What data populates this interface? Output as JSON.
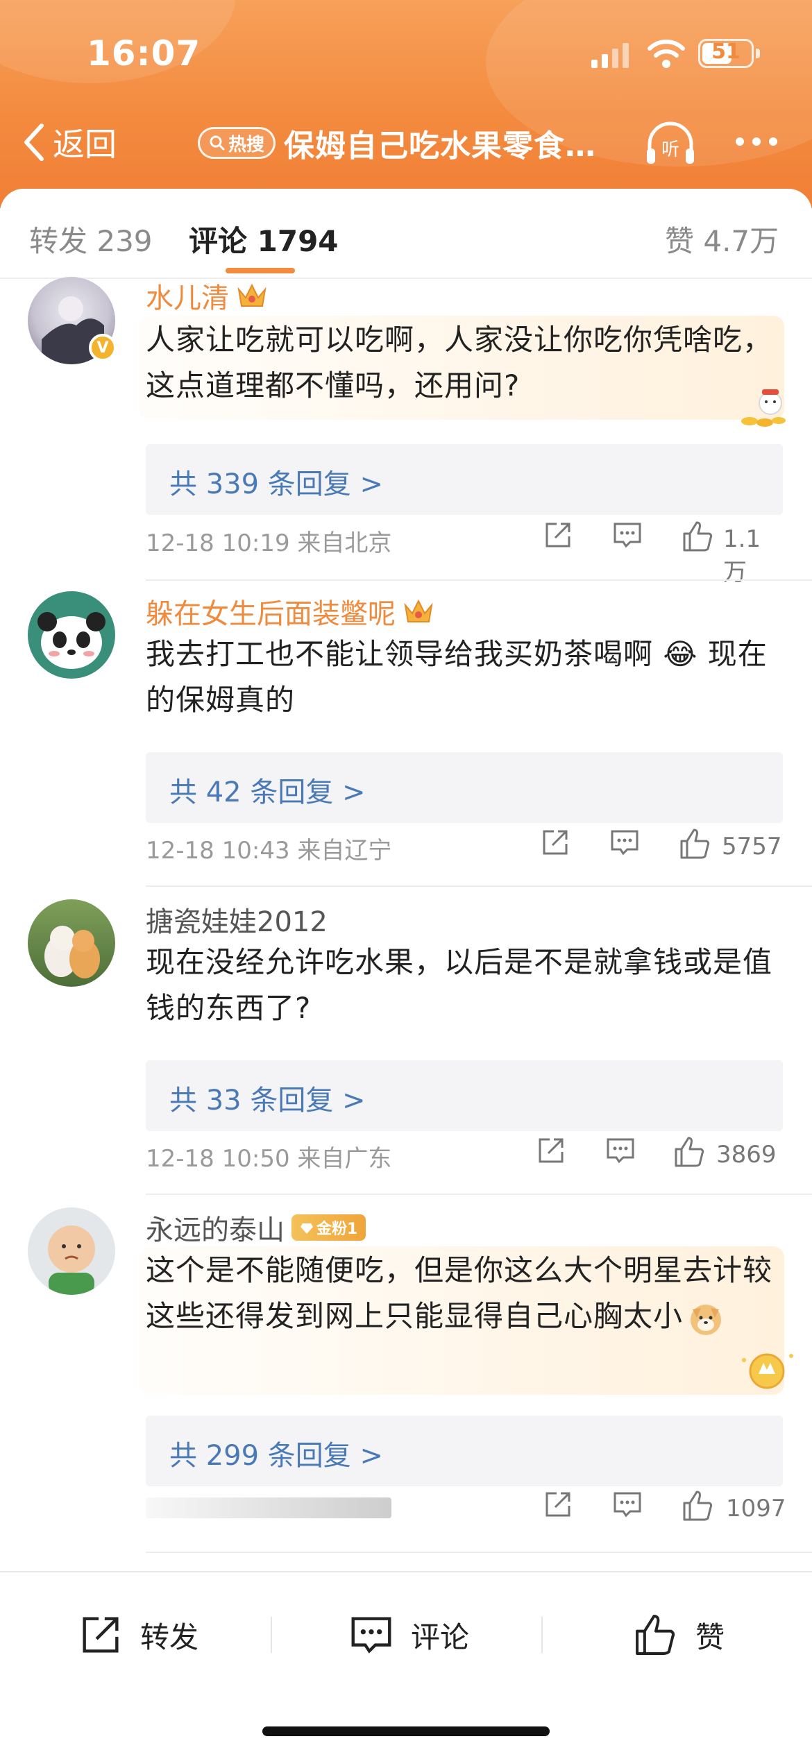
{
  "status_bar": {
    "time": "16:07",
    "battery": "51"
  },
  "nav": {
    "back_label": "返回",
    "hot_badge": "热搜",
    "title": "保姆自己吃水果零食…",
    "listen_label": "听"
  },
  "tabs": {
    "repost": "转发 239",
    "comments": "评论 1794",
    "likes": "赞 4.7万"
  },
  "comments": [
    {
      "username": "水儿清",
      "text": "人家让吃就可以吃啊，人家没让你吃你凭啥吃，这点道理都不懂吗，还用问?",
      "replies": "共 339 条回复 >",
      "meta": "12-18 10:19  来自北京",
      "likes": "1.1万"
    },
    {
      "username": "躲在女生后面装鳖呢",
      "text": "我去打工也不能让领导给我买奶茶喝啊 😂 现在的保姆真的",
      "replies": "共 42 条回复 >",
      "meta": "12-18 10:43  来自辽宁",
      "likes": "5757"
    },
    {
      "username": "搪瓷娃娃2012",
      "text": "现在没经允许吃水果，以后是不是就拿钱或是值钱的东西了?",
      "replies": "共 33 条回复 >",
      "meta": "12-18 10:50  来自广东",
      "likes": "3869"
    },
    {
      "username": "永远的泰山",
      "badge": "金粉1",
      "text": "这个是不能随便吃，但是你这么大个明星去计较这些还得发到网上只能显得自己心胸太小",
      "replies": "共 299 条回复 >",
      "likes": "1097"
    }
  ],
  "bottom_bar": {
    "repost": "转发",
    "comment": "评论",
    "like": "赞"
  },
  "colors": {
    "accent": "#f38b3f",
    "link": "#4a7ab5",
    "username_orange": "#f08a3d"
  }
}
